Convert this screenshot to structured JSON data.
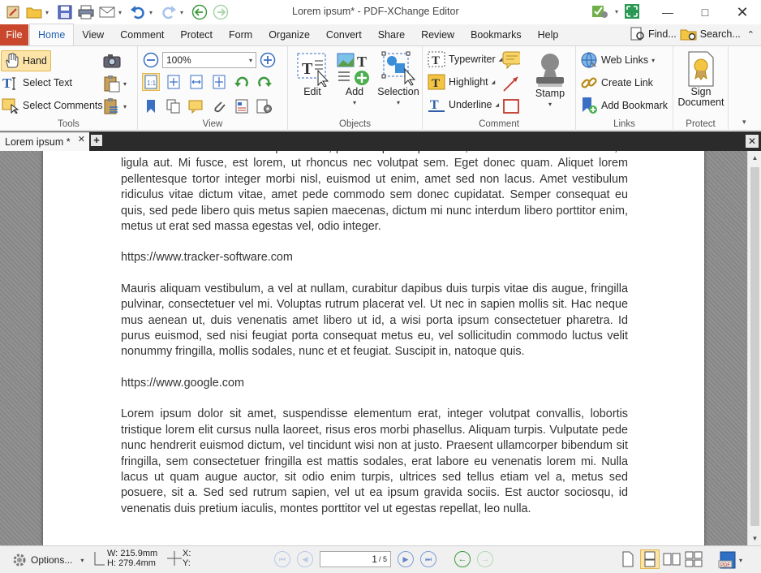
{
  "window": {
    "title": "Lorem ipsum* - PDF-XChange Editor"
  },
  "menu": {
    "tabs": [
      "File",
      "Home",
      "View",
      "Comment",
      "Protect",
      "Form",
      "Organize",
      "Convert",
      "Share",
      "Review",
      "Bookmarks",
      "Help"
    ],
    "active": "Home",
    "find_label": "Find...",
    "search_label": "Search..."
  },
  "ribbon": {
    "tools": {
      "label": "Tools",
      "hand": "Hand",
      "select_text": "Select Text",
      "select_comments": "Select Comments"
    },
    "view": {
      "label": "View",
      "zoom_value": "100%"
    },
    "objects": {
      "label": "Objects",
      "edit": "Edit",
      "add": "Add",
      "selection": "Selection"
    },
    "comment": {
      "label": "Comment",
      "typewriter": "Typewriter",
      "highlight": "Highlight",
      "underline": "Underline",
      "stamp": "Stamp"
    },
    "links": {
      "label": "Links",
      "web_links": "Web Links",
      "create_link": "Create Link",
      "add_bookmark": "Add Bookmark"
    },
    "protect": {
      "label": "Protect",
      "sign_line1": "Sign",
      "sign_line2": "Document"
    }
  },
  "document_tab": {
    "name": "Lorem ipsum *"
  },
  "document": {
    "paragraph1": "tellus amet iaculibus ullamcorper labore, posuere purus ipsum vel, dictum tortor facilisis mattis, a ligula aut. Mi fusce, est lorem, ut rhoncus nec volutpat sem. Eget donec quam. Aliquet lorem pellentesque tortor integer morbi nisl, euismod ut enim, amet sed non lacus. Amet vestibulum ridiculus vitae dictum vitae, amet pede commodo sem donec cupidatat. Semper consequat eu quis, sed pede libero quis metus sapien maecenas, dictum mi nunc interdum libero porttitor enim, metus ut erat sed massa egestas vel, odio integer.",
    "link1": "https://www.tracker-software.com",
    "paragraph2": "Mauris aliquam vestibulum, a vel at nullam, curabitur dapibus duis turpis vitae dis augue, fringilla pulvinar, consectetuer vel mi. Voluptas rutrum placerat vel. Ut nec in sapien mollis sit. Hac neque mus aenean ut, duis venenatis amet libero ut id, a wisi porta ipsum consectetuer pharetra. Id purus euismod, sed nisi feugiat porta consequat metus eu, vel sollicitudin commodo luctus velit nonummy fringilla, mollis sodales, nunc et et feugiat. Suscipit in, natoque quis.",
    "link2": "https://www.google.com",
    "paragraph3": "Lorem ipsum dolor sit amet, suspendisse elementum erat, integer volutpat convallis, lobortis tristique lorem elit cursus nulla laoreet, risus eros morbi phasellus. Aliquam turpis. Vulputate pede nunc hendrerit euismod dictum, vel tincidunt wisi non at justo. Praesent ullamcorper bibendum sit fringilla, sem consectetuer fringilla est mattis sodales, erat labore eu venenatis lorem mi. Nulla lacus ut quam augue auctor, sit odio enim turpis, ultrices sed tellus etiam vel a, metus sed posuere, sit a. Sed sed rutrum sapien, vel ut ea ipsum gravida sociis. Est auctor sociosqu, id venenatis duis pretium iaculis, montes porttitor vel ut egestas repellat, leo nulla."
  },
  "statusbar": {
    "options_label": "Options...",
    "width_label": "W:",
    "width_value": "215.9mm",
    "height_label": "H:",
    "height_value": "279.4mm",
    "x_label": "X:",
    "y_label": "Y:",
    "page_current": "1",
    "page_total": "/ 5"
  },
  "colors": {
    "file_tab": "#c9482d",
    "active_tool": "#fce4a8",
    "accent": "#1f5fb0"
  }
}
